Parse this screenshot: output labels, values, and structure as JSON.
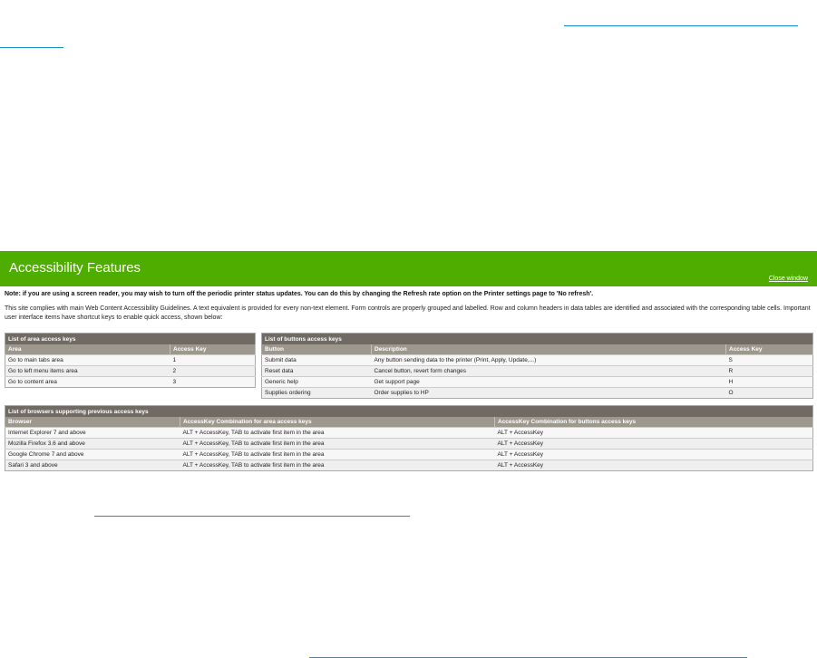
{
  "header": {
    "title": "Accessibility Features",
    "close_label": "Close window"
  },
  "note": "Note: if you are using a screen reader, you may wish to turn off the periodic printer status updates. You can do this by changing the Refresh rate option on the Printer settings page to 'No refresh'.",
  "intro": "This site complies with main Web Content Accessibility Guidelines. A text equivalent is provided for every non-text element. Form controls are properly grouped and labelled. Row and column headers in data tables are identified and associated with the corresponding table cells. Important user interface items have shortcut keys to enable quick access, shown below:",
  "area_table": {
    "caption": "List of area access keys",
    "headers": [
      "Area",
      "Access Key"
    ],
    "rows": [
      [
        "Go to main tabs area",
        "1"
      ],
      [
        "Go to left menu items area",
        "2"
      ],
      [
        "Go to content area",
        "3"
      ]
    ]
  },
  "buttons_table": {
    "caption": "List of buttons access keys",
    "headers": [
      "Button",
      "Description",
      "Access Key"
    ],
    "rows": [
      [
        "Submit data",
        "Any button sending data to the printer (Print, Apply, Update,...)",
        "S"
      ],
      [
        "Reset data",
        "Cancel button, revert form changes",
        "R"
      ],
      [
        "Generic help",
        "Get support page",
        "H"
      ],
      [
        "Supplies ordering",
        "Order supplies to HP",
        "O"
      ]
    ]
  },
  "browsers_table": {
    "caption": "List of browsers supporting previous access keys",
    "headers": [
      "Browser",
      "AccessKey Combination for area access keys",
      "AccessKey Combination for buttons access keys"
    ],
    "rows": [
      [
        "Internet Explorer 7 and above",
        "ALT + AccessKey, TAB to activate first item in the area",
        "ALT + AccessKey"
      ],
      [
        "Mozilla Firefox 3.6 and above",
        "ALT + AccessKey, TAB to activate first item in the area",
        "ALT + AccessKey"
      ],
      [
        "Google Chrome 7 and above",
        "ALT + AccessKey, TAB to activate first item in the area",
        "ALT + AccessKey"
      ],
      [
        "Safari 3 and above",
        "ALT + AccessKey, TAB to activate first item in the area",
        "ALT + AccessKey"
      ]
    ]
  }
}
